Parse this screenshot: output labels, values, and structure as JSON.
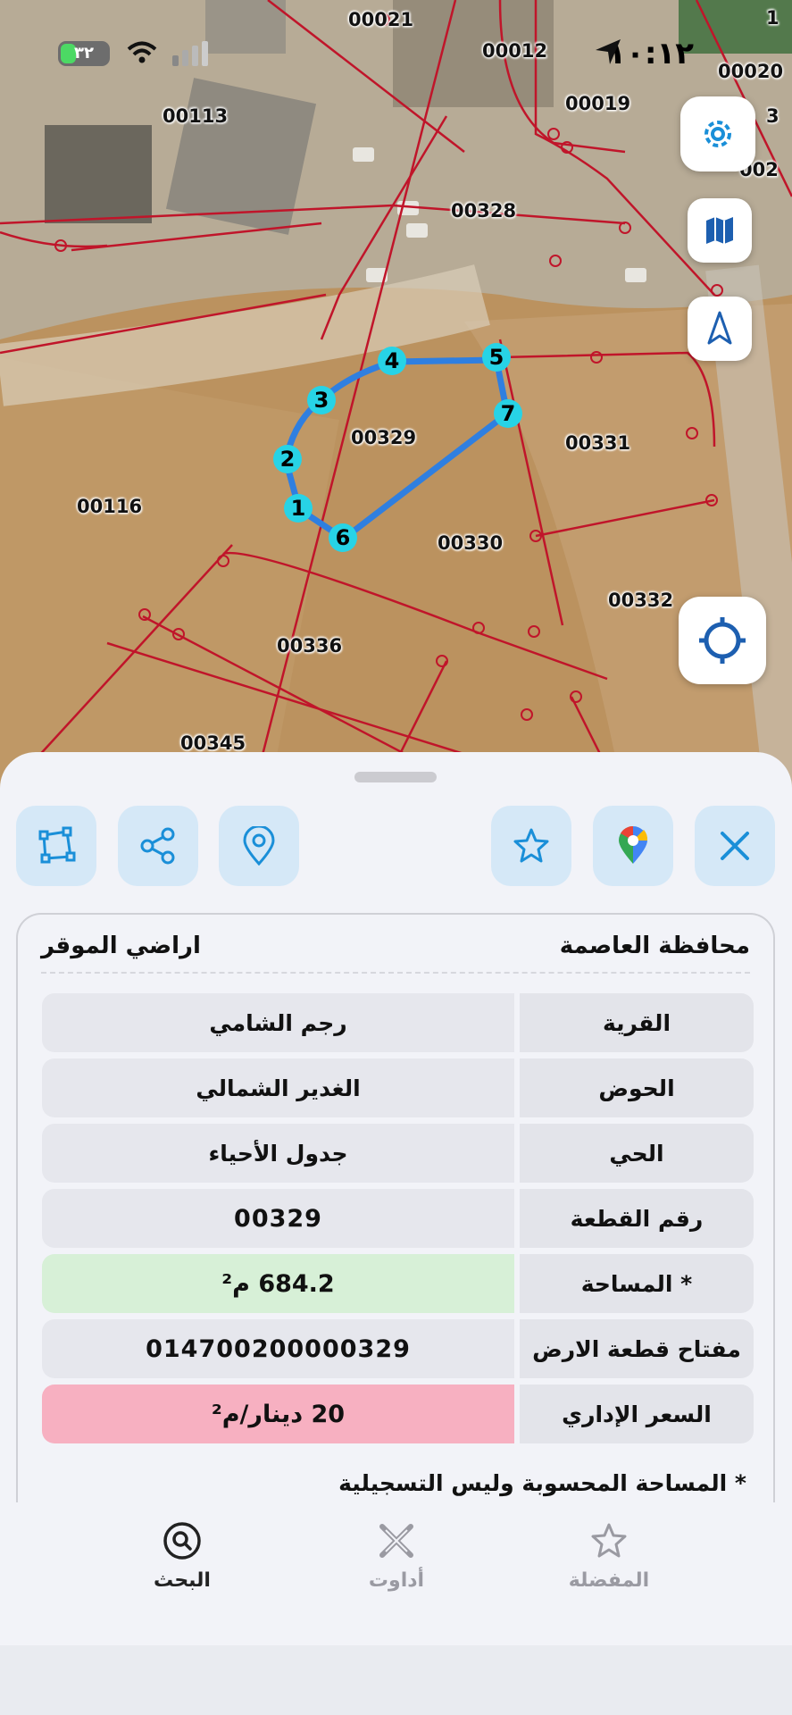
{
  "status": {
    "time": "١٠:١٢",
    "battery": "٣٢"
  },
  "map": {
    "parcels": [
      {
        "id": "00021"
      },
      {
        "id": "00012"
      },
      {
        "id": "00020"
      },
      {
        "id": "00113"
      },
      {
        "id": "00019"
      },
      {
        "id": "00328"
      },
      {
        "id": "00329"
      },
      {
        "id": "00331"
      },
      {
        "id": "00116"
      },
      {
        "id": "00330"
      },
      {
        "id": "00332"
      },
      {
        "id": "00336"
      },
      {
        "id": "00345"
      },
      {
        "id": "1"
      },
      {
        "id": "3"
      },
      {
        "id": "002"
      }
    ],
    "vertices": [
      "1",
      "2",
      "3",
      "4",
      "5",
      "6",
      "7"
    ],
    "buttons": [
      "settings-icon",
      "map-icon",
      "compass-icon",
      "locate-icon"
    ]
  },
  "actions": [
    "polygon-icon",
    "share-icon",
    "pin-icon",
    "star-icon",
    "google-maps-icon",
    "close-icon"
  ],
  "card": {
    "governorate": "محافظة العاصمة",
    "lands": "اراضي الموقر",
    "rows": [
      {
        "key": "القرية",
        "value": "رجم الشامي"
      },
      {
        "key": "الحوض",
        "value": "الغدير الشمالي"
      },
      {
        "key": "الحي",
        "value": "جدول الأحياء"
      },
      {
        "key": "رقم القطعة",
        "value": "00329"
      },
      {
        "key": "المساحة *",
        "value": "684.2 م²"
      },
      {
        "key": "مفتاح قطعة الارض",
        "value": "014700200000329"
      },
      {
        "key": "السعر الإداري",
        "value": "20 دينار/م²"
      }
    ],
    "note": "* المساحة المحسوبة وليس التسجيلية"
  },
  "tabs": {
    "search": "البحث",
    "tools": "أداوت",
    "favorites": "المفضلة"
  },
  "colors": {
    "accent": "#1a8fd8",
    "parcel_outline": "#2f7fe0",
    "vertex": "#27d3e6",
    "lines": "#c0152a"
  }
}
